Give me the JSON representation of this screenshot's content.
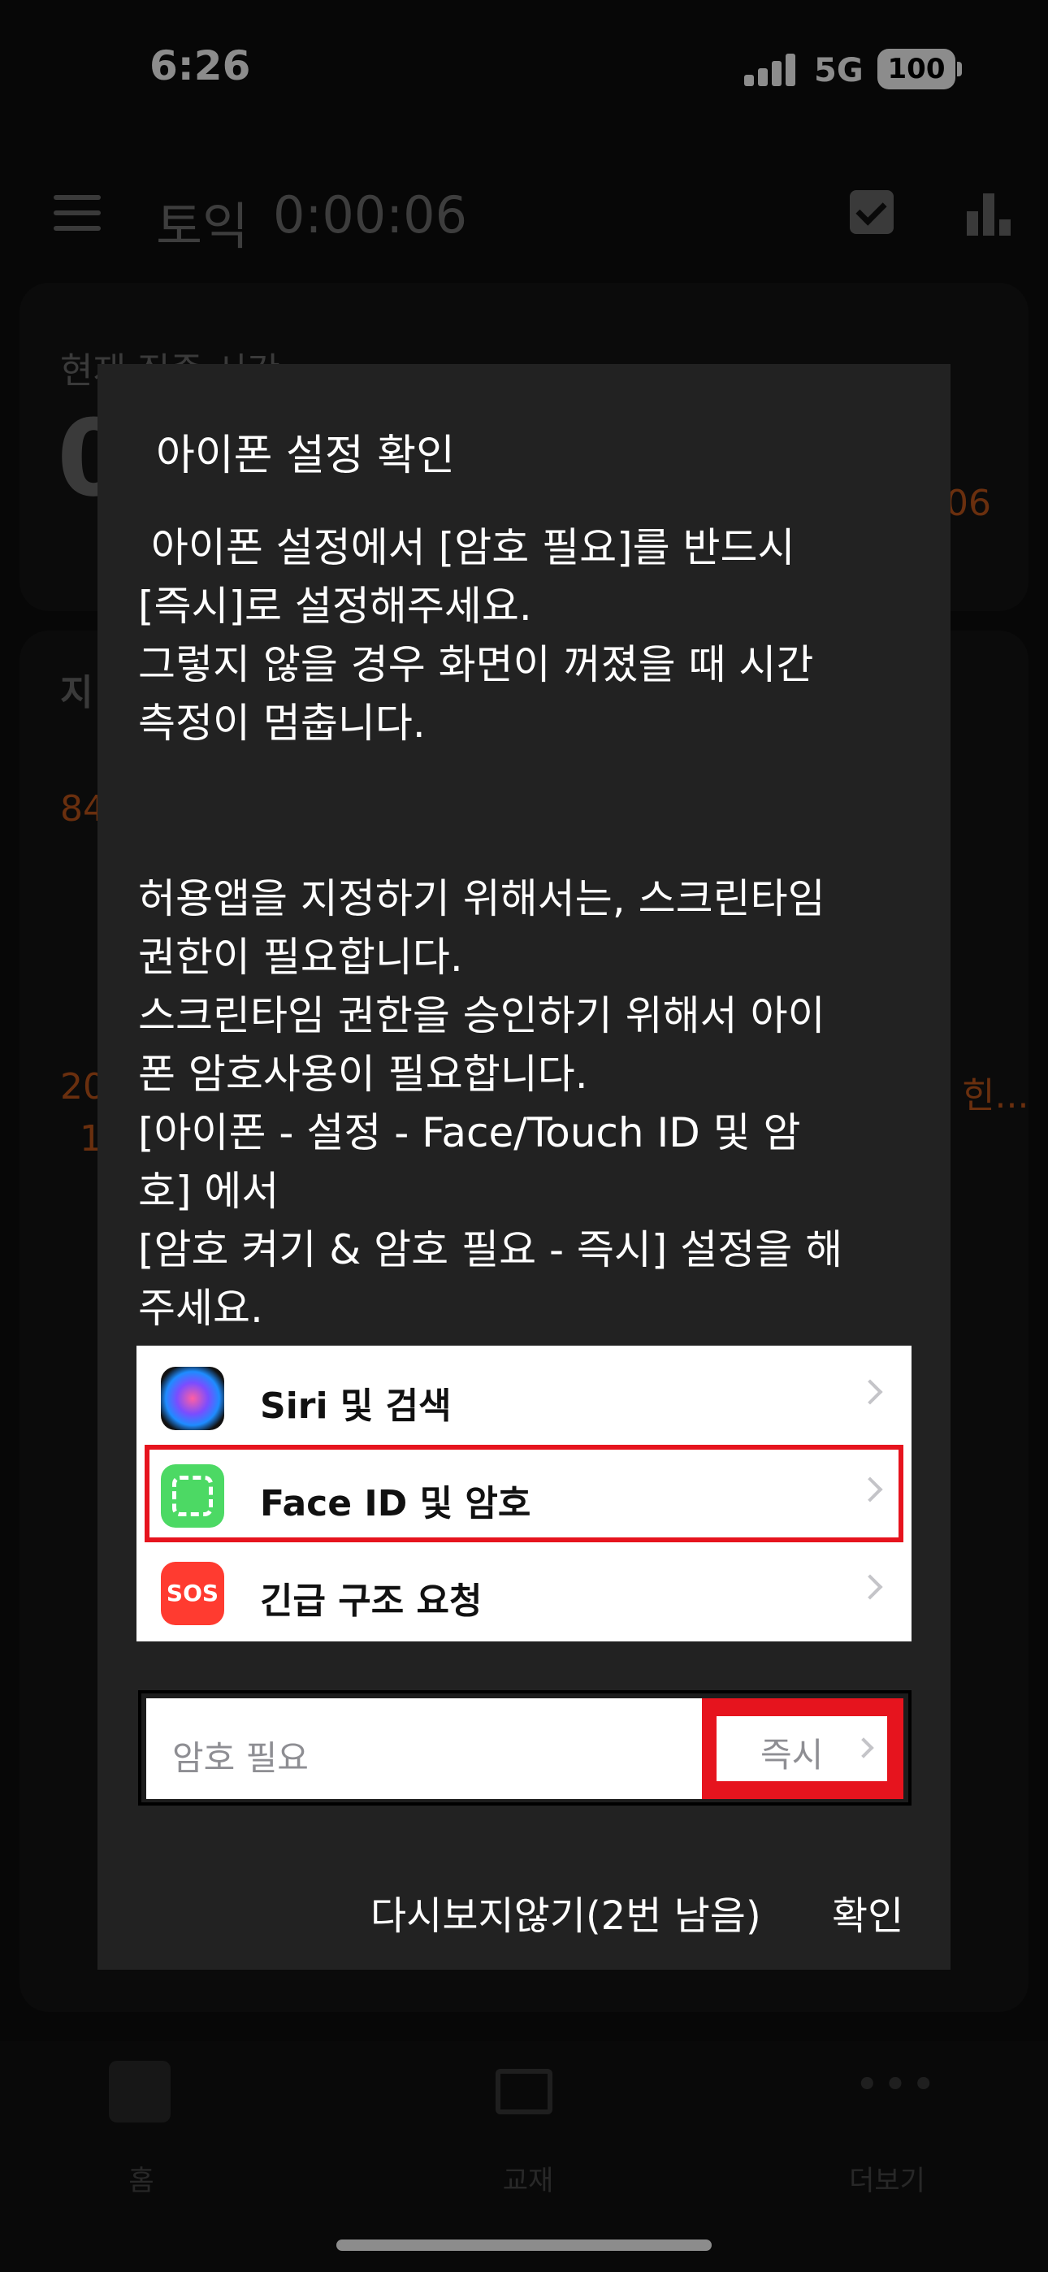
{
  "status_bar": {
    "time": "6:26",
    "network": "5G",
    "battery": "100"
  },
  "header": {
    "title": "토익",
    "timer": "0:00:06"
  },
  "background": {
    "focus_label": "현재 집중 시간",
    "focus_value_partial": "0",
    "right_timer_partial": "06",
    "section_label_partial": "지",
    "value_84": "84",
    "value_20": "20",
    "value_1": "1",
    "right_link_partial": "힌..."
  },
  "bottom_nav": {
    "items": [
      {
        "label": "홈"
      },
      {
        "label": "교재"
      },
      {
        "label": "더보기"
      }
    ]
  },
  "dialog": {
    "title": "아이폰 설정 확인",
    "body": " 아이폰 설정에서 [암호 필요]를 반드시\n[즉시]로 설정해주세요.\n그렇지 않을 경우 화면이 꺼졌을 때 시간\n측정이 멈춥니다.\n\n\n허용앱을 지정하기 위해서는, 스크린타임\n권한이 필요합니다.\n스크린타임 권한을 승인하기 위해서 아이\n폰 암호사용이 필요합니다.\n[아이폰 - 설정 - Face/Touch ID 및 암\n호] 에서\n[암호 켜기 & 암호 필요 - 즉시] 설정을 해\n주세요.",
    "settings_rows": [
      {
        "label": "Siri 및 검색",
        "icon": "siri-icon"
      },
      {
        "label": "Face ID 및 암호",
        "icon": "faceid-icon"
      },
      {
        "label": "긴급 구조 요청",
        "icon": "sos-icon",
        "icon_text": "SOS"
      }
    ],
    "passcode": {
      "label": "암호 필요",
      "value": "즉시"
    },
    "dont_show_button": "다시보지않기(2번 남음)",
    "confirm_button": "확인"
  },
  "colors": {
    "accent": "#c2561a",
    "highlight": "#e6141e",
    "dialog_bg": "#222222"
  }
}
